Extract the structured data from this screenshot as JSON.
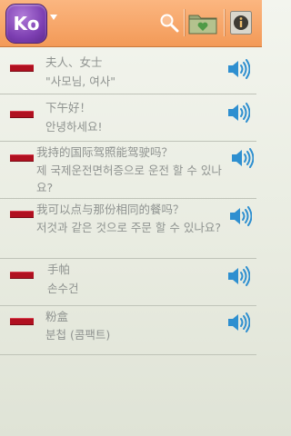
{
  "app": {
    "logo_text": "Ko",
    "accent_color": "#f39a58",
    "logo_color": "#7d3fb2",
    "icons": [
      "search-icon",
      "folder-heart-icon",
      "info-icon"
    ]
  },
  "phrases": [
    {
      "chinese": "夫人、女士",
      "korean": "\"사모님, 여사\""
    },
    {
      "chinese": "下午好！",
      "korean": "안녕하세요!"
    },
    {
      "chinese": "我持的国际驾照能驾驶吗？",
      "korean": "제 국제운전면허증으로 운전 할 수 있나요?"
    },
    {
      "chinese": "我可以点与那份相同的餐吗？",
      "korean": "저것과 같은 것으로 주문 할 수 있나요?"
    },
    {
      "chinese": "手帕",
      "korean": "손수건"
    },
    {
      "chinese": "粉盒",
      "korean": "분첩 (콤팩트)"
    }
  ]
}
